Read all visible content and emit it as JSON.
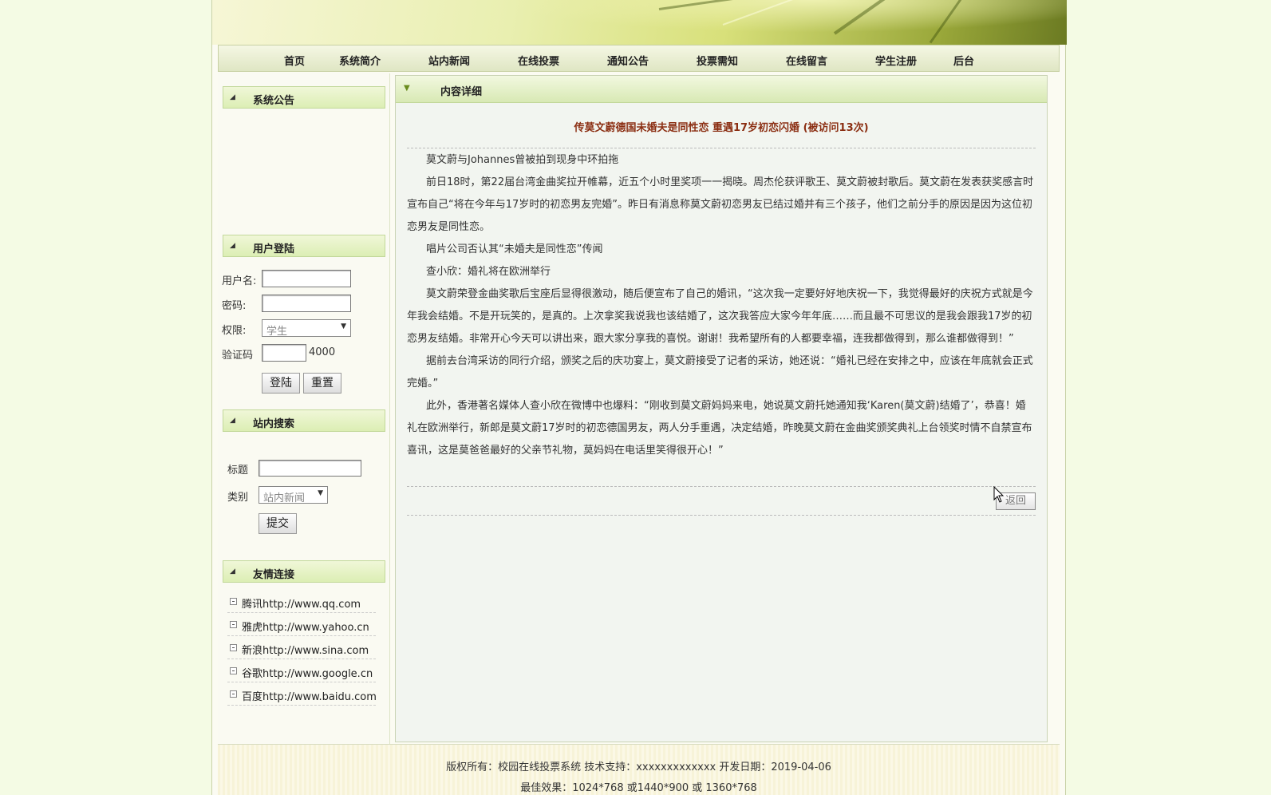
{
  "nav": {
    "items": [
      "首页",
      "系统简介",
      "站内新闻",
      "在线投票",
      "通知公告",
      "投票需知",
      "在线留言",
      "学生注册",
      "后台"
    ]
  },
  "sidebar": {
    "announcement_title": "系统公告",
    "login": {
      "title": "用户登陆",
      "username_label": "用户名:",
      "username_value": "",
      "password_label": "密码:",
      "password_value": "",
      "role_label": "权限:",
      "role_selected": "学生",
      "captcha_label": "验证码",
      "captcha_value": "",
      "captcha_code": "4000",
      "login_button": "登陆",
      "reset_button": "重置"
    },
    "search": {
      "title": "站内搜索",
      "title_label": "标题",
      "title_value": "",
      "category_label": "类别",
      "category_selected": "站内新闻",
      "submit_button": "提交"
    },
    "links": {
      "title": "友情连接",
      "items": [
        "腾讯http://www.qq.com",
        "雅虎http://www.yahoo.cn",
        "新浪http://www.sina.com",
        "谷歌http://www.google.cn",
        "百度http://www.baidu.com"
      ]
    }
  },
  "main": {
    "header": "内容详细",
    "article_title": "传莫文蔚德国未婚夫是同性恋 重遇17岁初恋闪婚 (被访问13次)",
    "paragraphs": [
      "莫文蔚与Johannes曾被拍到现身中环拍拖",
      "前日18时，第22届台湾金曲奖拉开帷幕，近五个小时里奖项一一揭晓。周杰伦获评歌王、莫文蔚被封歌后。莫文蔚在发表获奖感言时宣布自己“将在今年与17岁时的初恋男友完婚”。昨日有消息称莫文蔚初恋男友已结过婚并有三个孩子，他们之前分手的原因是因为这位初恋男友是同性恋。",
      "唱片公司否认其“未婚夫是同性恋”传闻",
      "查小欣：婚礼将在欧洲举行",
      "莫文蔚荣登金曲奖歌后宝座后显得很激动，随后便宣布了自己的婚讯，“这次我一定要好好地庆祝一下，我觉得最好的庆祝方式就是今年我会结婚。不是开玩笑的，是真的。上次拿奖我说我也该结婚了，这次我答应大家今年年底……而且最不可思议的是我会跟我17岁的初恋男友结婚。非常开心今天可以讲出来，跟大家分享我的喜悦。谢谢！我希望所有的人都要幸福，连我都做得到，那么谁都做得到！”",
      "据前去台湾采访的同行介绍，颁奖之后的庆功宴上，莫文蔚接受了记者的采访，她还说：“婚礼已经在安排之中，应该在年底就会正式完婚。”",
      "此外，香港著名媒体人查小欣在微博中也爆料：“刚收到莫文蔚妈妈来电，她说莫文蔚托她通知我‘Karen(莫文蔚)结婚了’，恭喜！婚礼在欧洲举行，新郎是莫文蔚17岁时的初恋德国男友，两人分手重遇，决定结婚，昨晚莫文蔚在金曲奖颁奖典礼上台领奖时情不自禁宣布喜讯，这是莫爸爸最好的父亲节礼物，莫妈妈在电话里笑得很开心！”"
    ],
    "back_button": "返回"
  },
  "footer": {
    "line1": "版权所有：校园在线投票系统 技术支持：xxxxxxxxxxxxx 开发日期：2019-04-06",
    "line2": "最佳效果：1024*768 或1440*900 或 1360*768"
  }
}
